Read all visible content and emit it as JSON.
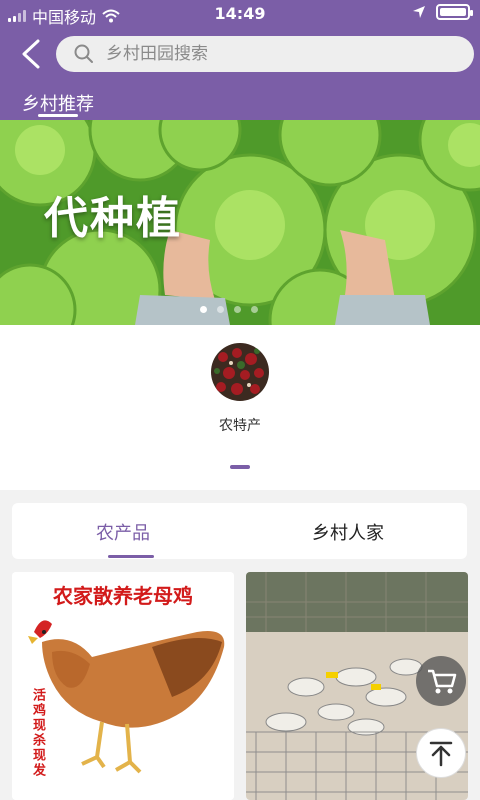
{
  "status": {
    "carrier": "中国移动",
    "time": "14:49"
  },
  "search": {
    "placeholder": "乡村田园搜索"
  },
  "header": {
    "tab_label": "乡村推荐"
  },
  "banner": {
    "title": "代种植",
    "dot_count": 4,
    "active_dot": 0
  },
  "categories": [
    {
      "label": "农特产",
      "icon": "local-specialty-image"
    }
  ],
  "tabs": [
    {
      "label": "农产品",
      "active": true
    },
    {
      "label": "乡村人家",
      "active": false
    }
  ],
  "products": [
    {
      "title": "农家散养老母鸡",
      "side_text": "活鸡现杀现发",
      "image": "hen-photo"
    },
    {
      "title": "",
      "image": "geese-farm-photo"
    }
  ],
  "fab": {
    "cart_icon": "cart-icon",
    "top_icon": "back-to-top-icon"
  },
  "colors": {
    "accent": "#7b5ea7",
    "red": "#d21a1a"
  }
}
